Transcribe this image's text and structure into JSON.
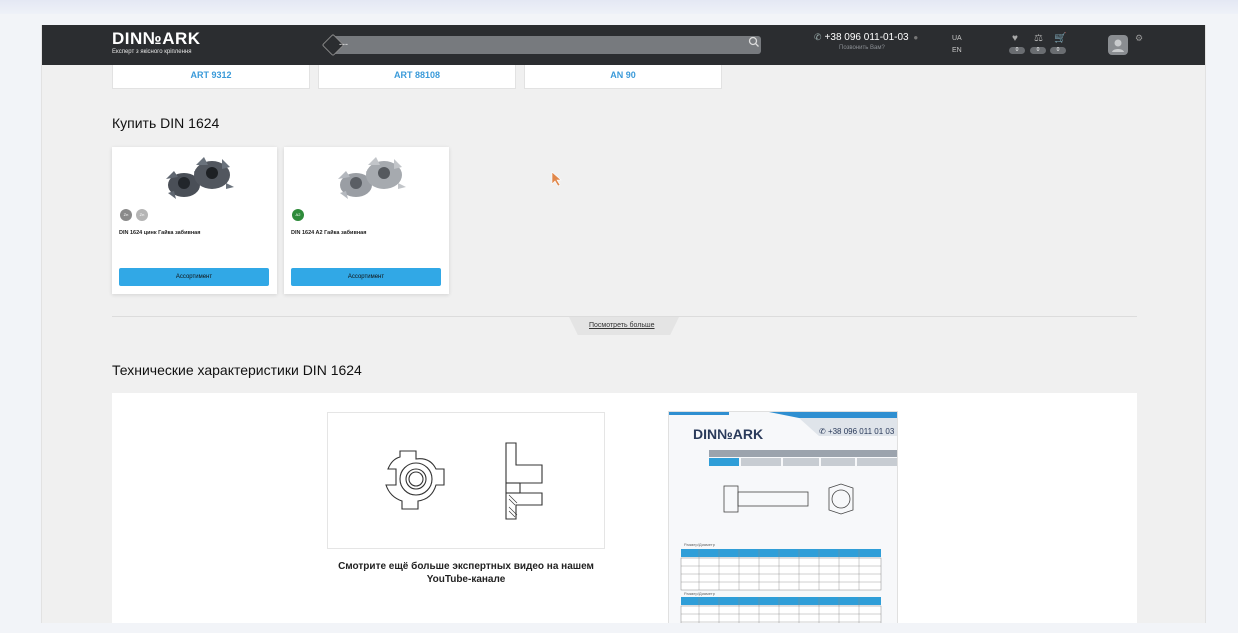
{
  "header": {
    "logo": "DIN№ARK",
    "tagline": "Експерт з якісного кріплення",
    "search_value": "---",
    "phone": "+38 096 011-01-03",
    "callback": "Позвонить Вам?",
    "lang_ua": "UA",
    "lang_en": "EN",
    "wishlist_count": "0",
    "compare_count": "0",
    "cart_count": "0"
  },
  "related": [
    {
      "label": "ART 9312"
    },
    {
      "label": "ART 88108"
    },
    {
      "label": "AN 90"
    }
  ],
  "buy_section": {
    "title": "Купить DIN 1624",
    "products": [
      {
        "name": "DIN 1624 цинк Гайка забивная",
        "button": "Ассортимент",
        "chips": [
          {
            "text": "Zn",
            "color": "#8a8a8a"
          },
          {
            "text": "Zn",
            "color": "#b5b5b5"
          }
        ]
      },
      {
        "name": "DIN 1624 A2 Гайка забивная",
        "button": "Ассортимент",
        "chips": [
          {
            "text": "A2",
            "color": "#2e8b3a"
          }
        ]
      }
    ],
    "more": "Посмотреть больше"
  },
  "tech": {
    "title": "Технические характеристики DIN 1624",
    "video_caption": "Смотрите ещё больше экспертных видео на нашем YouTube-канале",
    "datasheet": {
      "logo": "DIN№ARK",
      "phone": "+38 096 011 01 03",
      "label1": "Размер/Диаметр",
      "label2": "Размер/Диаметр"
    }
  },
  "colors": {
    "accent": "#31a8e6",
    "header": "#2b2d30",
    "link": "#3a9ad9"
  }
}
